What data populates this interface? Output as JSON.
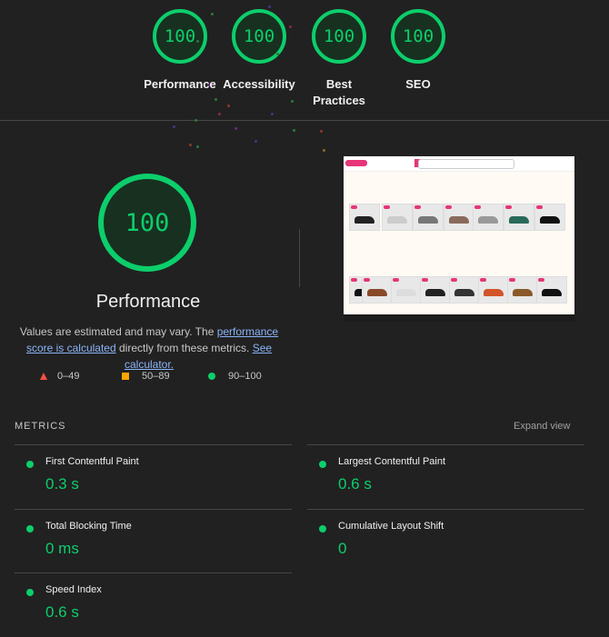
{
  "summary": [
    {
      "score": "100",
      "label": "Performance"
    },
    {
      "score": "100",
      "label": "Accessibility"
    },
    {
      "score": "100",
      "label": "Best Practices"
    },
    {
      "score": "100",
      "label": "SEO"
    }
  ],
  "main": {
    "score": "100",
    "title": "Performance",
    "note_pre": "Values are estimated and may vary. The ",
    "note_link1": "performance score is calculated",
    "note_mid": " directly from these metrics. ",
    "note_link2": "See calculator."
  },
  "legend": {
    "fail": "0–49",
    "average": "50–89",
    "pass": "90–100"
  },
  "colors": {
    "pass": "#0cce6b",
    "average": "#ffa400",
    "fail": "#ff4e42"
  },
  "metrics": {
    "heading": "METRICS",
    "expand": "Expand view",
    "items": [
      {
        "name": "First Contentful Paint",
        "value": "0.3 s"
      },
      {
        "name": "Largest Contentful Paint",
        "value": "0.6 s"
      },
      {
        "name": "Total Blocking Time",
        "value": "0 ms"
      },
      {
        "name": "Cumulative Layout Shift",
        "value": "0"
      },
      {
        "name": "Speed Index",
        "value": "0.6 s"
      }
    ]
  }
}
